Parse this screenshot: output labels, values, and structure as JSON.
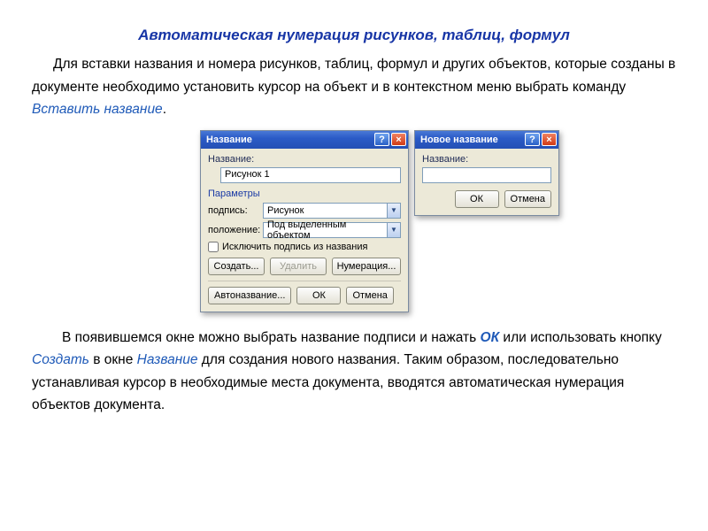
{
  "title": "Автоматическая нумерация рисунков, таблиц, формул",
  "para1": {
    "t1": "Для вставки названия и номера рисунков, таблиц, формул и других объектов, которые созданы в документе необходимо установить курсор на объект и в контекстном меню выбрать команду ",
    "cmd": "Вставить название",
    "t2": "."
  },
  "dialog1": {
    "title": "Название",
    "help": "?",
    "close": "×",
    "name_label": "Название:",
    "name_value": "Рисунок 1",
    "params_header": "Параметры",
    "caption_label": "подпись:",
    "caption_value": "Рисунок",
    "position_label": "положение:",
    "position_value": "Под выделенным объектом",
    "exclude_label": "Исключить подпись из названия",
    "btn_create": "Создать...",
    "btn_delete": "Удалить",
    "btn_numbering": "Нумерация...",
    "btn_autoname": "Автоназвание...",
    "btn_ok": "ОК",
    "btn_cancel": "Отмена"
  },
  "dialog2": {
    "title": "Новое название",
    "help": "?",
    "close": "×",
    "name_label": "Название:",
    "btn_ok": "ОК",
    "btn_cancel": "Отмена"
  },
  "para2": {
    "t1": "В появившемся окне можно выбрать название подписи и нажать ",
    "ok": "ОК",
    "t2": " или использовать кнопку ",
    "create": "Создать",
    "t3": " в окне ",
    "winname": "Название",
    "t4": " для создания нового названия. Таким образом, последовательно устанавливая курсор в необходимые места документа, вводятся  автоматическая нумерация объектов документа."
  }
}
